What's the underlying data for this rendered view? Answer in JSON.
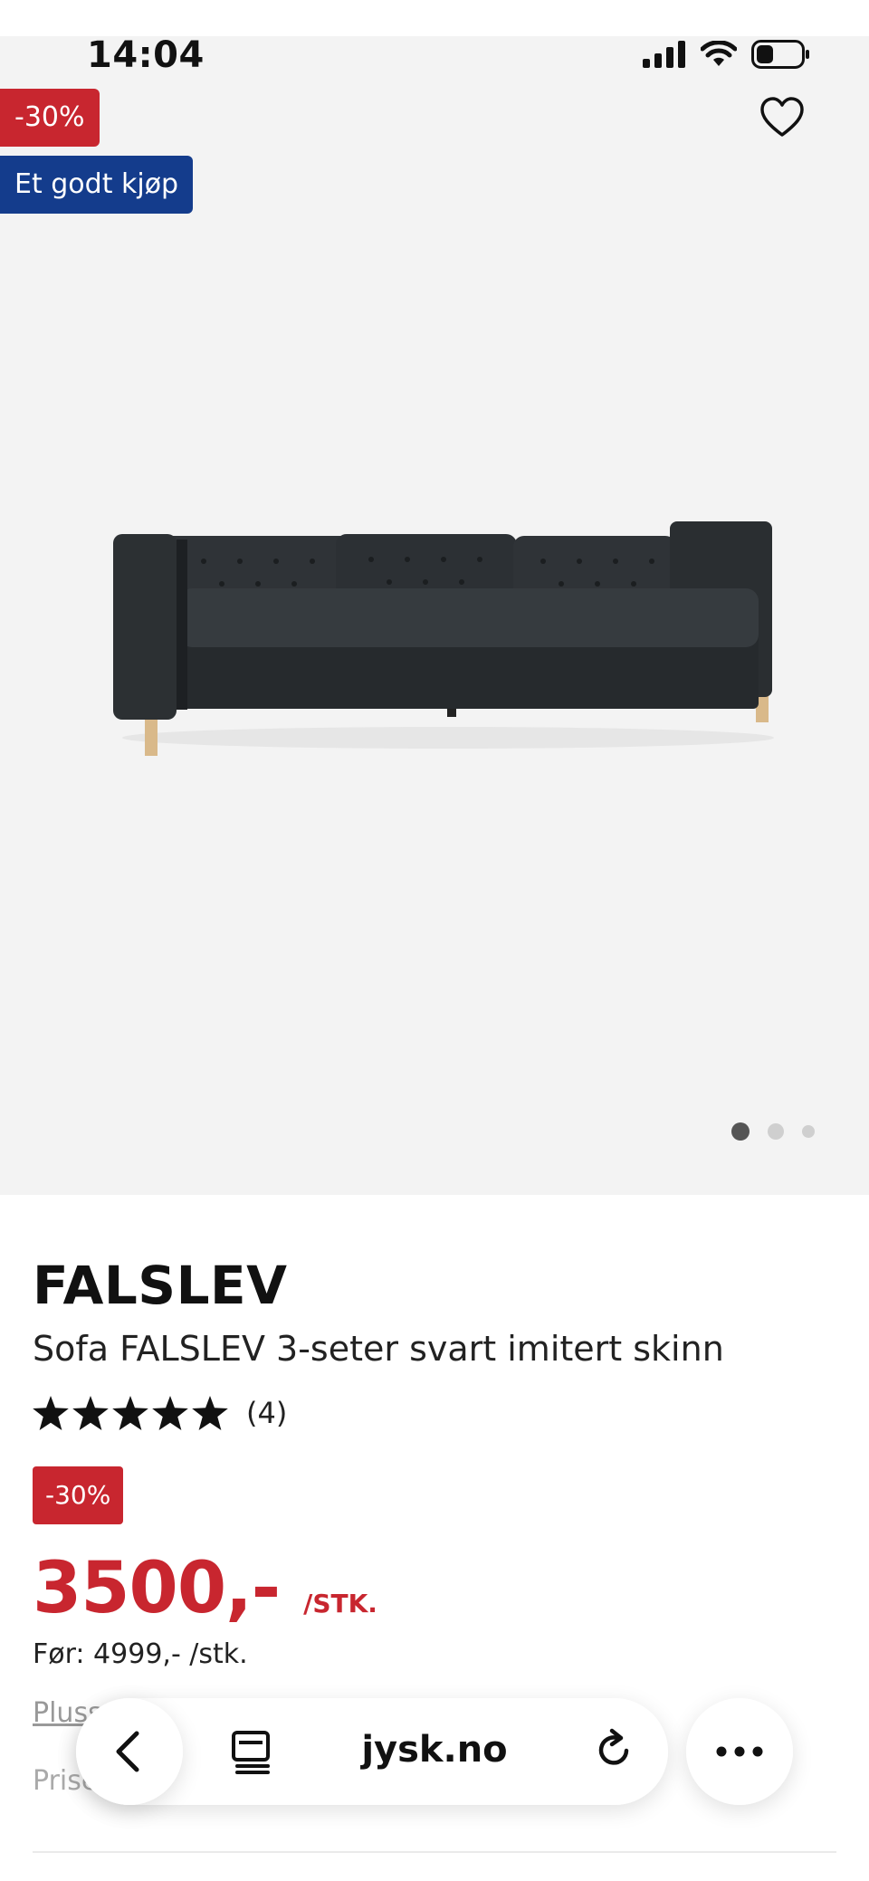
{
  "status_bar": {
    "time": "14:04",
    "icons": [
      "signal-icon",
      "wifi-icon",
      "battery-icon"
    ]
  },
  "gallery": {
    "badges": {
      "discount": "-30%",
      "deal": "Et godt kjøp"
    },
    "icons": {
      "wishlist": "heart-icon"
    },
    "image_alt": "sofa-image",
    "carousel": {
      "slides": 3,
      "active": 1
    }
  },
  "product": {
    "title": "FALSLEV",
    "subtitle": "Sofa FALSLEV 3-seter svart imitert skinn",
    "rating": {
      "stars": 5,
      "max": 5,
      "count": "(4)"
    },
    "discount_badge": "-30%",
    "price": "3500,-",
    "price_unit": "/STK.",
    "before_price": "Før: 4999,- /stk.",
    "plus_link": "Pluss fra",
    "price_note": "Prise er"
  },
  "browser": {
    "url": "jysk.no",
    "icons": [
      "chevron-left-icon",
      "tabs-icon",
      "reload-icon",
      "more-icon"
    ]
  },
  "colors": {
    "sale_red": "#c8262f",
    "deal_blue": "#143c8c",
    "hero_bg": "#f3f3f3"
  }
}
